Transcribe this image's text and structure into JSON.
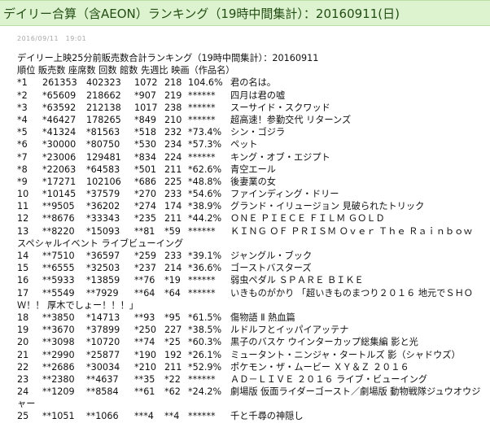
{
  "title": "デイリー合算（含AEON）ランキング（19時中間集計）：20160911(日)",
  "date": "2016/09/11　19:01",
  "article": {
    "heading": "デイリー上映25分前販売数合計ランキング（19時中間集計）：20160911",
    "columns": "順位 販売数 座席数 回数 館数 先週比 映画（作品名）",
    "rows": [
      {
        "rank": "*1",
        "sales": "261353",
        "seats": "402323",
        "times": "1072",
        "theaters": "218",
        "ratio": "104.6%",
        "title": "君の名は。"
      },
      {
        "rank": "*2",
        "sales": "*65609",
        "seats": "218662",
        "times": "*907",
        "theaters": "219",
        "ratio": "******",
        "title": "四月は君の嘘"
      },
      {
        "rank": "*3",
        "sales": "*63592",
        "seats": "212138",
        "times": "1017",
        "theaters": "238",
        "ratio": "******",
        "title": "スーサイド・スクワッド"
      },
      {
        "rank": "*4",
        "sales": "*46427",
        "seats": "178265",
        "times": "*849",
        "theaters": "210",
        "ratio": "******",
        "title": "超高速！参勤交代 リターンズ"
      },
      {
        "rank": "*5",
        "sales": "*41324",
        "seats": "*81563",
        "times": "*518",
        "theaters": "232",
        "ratio": "*73.4%",
        "title": "シン・ゴジラ"
      },
      {
        "rank": "*6",
        "sales": "*30000",
        "seats": "*80750",
        "times": "*530",
        "theaters": "234",
        "ratio": "*57.3%",
        "title": "ペット"
      },
      {
        "rank": "*7",
        "sales": "*23006",
        "seats": "129481",
        "times": "*834",
        "theaters": "224",
        "ratio": "******",
        "title": "キング・オブ・エジプト"
      },
      {
        "rank": "*8",
        "sales": "*22063",
        "seats": "*64583",
        "times": "*501",
        "theaters": "211",
        "ratio": "*62.6%",
        "title": "青空エール"
      },
      {
        "rank": "*9",
        "sales": "*17271",
        "seats": "102106",
        "times": "*686",
        "theaters": "225",
        "ratio": "*48.8%",
        "title": "後妻業の女"
      },
      {
        "rank": "10",
        "sales": "*10145",
        "seats": "*37579",
        "times": "*270",
        "theaters": "233",
        "ratio": "*54.6%",
        "title": "ファインディング・ドリー"
      },
      {
        "rank": "11",
        "sales": "**9505",
        "seats": "*36202",
        "times": "*274",
        "theaters": "174",
        "ratio": "*38.9%",
        "title": "グランド・イリュージョン 見破られたトリック"
      },
      {
        "rank": "12",
        "sales": "**8676",
        "seats": "*33343",
        "times": "*235",
        "theaters": "211",
        "ratio": "*44.2%",
        "title": "ＯＮＥ ＰＩＥＣＥ ＦＩＬＭ ＧＯＬＤ"
      },
      {
        "rank": "13",
        "sales": "**8220",
        "seats": "*15093",
        "times": "**81",
        "theaters": "*59",
        "ratio": "******",
        "title": "ＫＩＮＧ ＯＦ ＰＲＩＳＭ Ｏｖｅｒ Ｔｈｅ Ｒａｉｎｂｏｗスペシャルイベント ライブビューイング",
        "wrap": true
      },
      {
        "rank": "14",
        "sales": "**7510",
        "seats": "*36597",
        "times": "*259",
        "theaters": "233",
        "ratio": "*39.1%",
        "title": "ジャングル・ブック"
      },
      {
        "rank": "15",
        "sales": "**6555",
        "seats": "*32503",
        "times": "*237",
        "theaters": "214",
        "ratio": "*36.6%",
        "title": "ゴーストバスターズ"
      },
      {
        "rank": "16",
        "sales": "**5933",
        "seats": "*13859",
        "times": "**76",
        "theaters": "*19",
        "ratio": "******",
        "title": "弱虫ペダル ＳＰＡＲＥ ＢＩＫＥ"
      },
      {
        "rank": "17",
        "sales": "**5549",
        "seats": "**7929",
        "times": "**64",
        "theaters": "*64",
        "ratio": "******",
        "title": "いきものがかり 「超いきものまつり２０１６ 地元でＳＨＯＷ！！ 厚木でしょー！！！」",
        "wrap": true
      },
      {
        "rank": "18",
        "sales": "**3850",
        "seats": "*14713",
        "times": "**93",
        "theaters": "*95",
        "ratio": "*61.5%",
        "title": "傷物語 Ⅱ 熱血篇"
      },
      {
        "rank": "19",
        "sales": "**3670",
        "seats": "*37899",
        "times": "*250",
        "theaters": "227",
        "ratio": "*38.5%",
        "title": "ルドルフとイッパイアッテナ"
      },
      {
        "rank": "20",
        "sales": "**3098",
        "seats": "*10720",
        "times": "**74",
        "theaters": "*25",
        "ratio": "*60.3%",
        "title": "黒子のバスケ ウインターカップ総集編 影と光"
      },
      {
        "rank": "21",
        "sales": "**2990",
        "seats": "*25877",
        "times": "*190",
        "theaters": "192",
        "ratio": "*26.1%",
        "title": "ミュータント・ニンジャ・タートルズ 影（シャドウズ）"
      },
      {
        "rank": "22",
        "sales": "**2686",
        "seats": "*30034",
        "times": "*210",
        "theaters": "211",
        "ratio": "*52.9%",
        "title": "ポケモン・ザ・ムービー ＸＹ＆Ｚ ２０１６"
      },
      {
        "rank": "23",
        "sales": "**2380",
        "seats": "**4637",
        "times": "**35",
        "theaters": "*22",
        "ratio": "******",
        "title": "ＡＤ－ＬＩＶＥ ２０１６ ライブ・ビューイング"
      },
      {
        "rank": "24",
        "sales": "**1209",
        "seats": "**8584",
        "times": "**61",
        "theaters": "*62",
        "ratio": "*24.2%",
        "title": "劇場版 仮面ライダーゴースト／劇場版 動物戦隊ジュウオウジャー",
        "wrap": true
      },
      {
        "rank": "25",
        "sales": "**1051",
        "seats": "**1066",
        "times": "***4",
        "theaters": "**4",
        "ratio": "******",
        "title": "千と千尋の神隠し"
      }
    ]
  }
}
